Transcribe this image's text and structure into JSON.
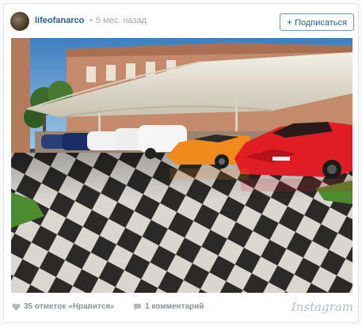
{
  "post": {
    "username": "lifeofanarco",
    "timestamp": "5 мес. назад",
    "follow_label": "Подписаться",
    "likes_label": "35 отметок «Нравится»",
    "comments_label": "1 комментарий",
    "brand": "Instagram"
  },
  "icons": {
    "follow": "plus-icon",
    "likes": "heart-icon",
    "comments": "comment-icon"
  },
  "colors": {
    "link": "#2d5f8a",
    "muted": "#a5a7aa",
    "button_border": "#6f97b6"
  }
}
